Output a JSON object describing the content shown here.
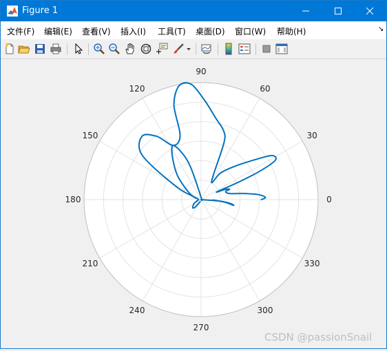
{
  "window": {
    "title": "Figure 1",
    "accent_color": "#0078d7",
    "controls": {
      "minimize_icon": "minimize-icon",
      "maximize_icon": "maximize-icon",
      "close_icon": "close-icon"
    }
  },
  "menu": {
    "items": [
      {
        "label": "文件(F)"
      },
      {
        "label": "编辑(E)"
      },
      {
        "label": "查看(V)"
      },
      {
        "label": "插入(I)"
      },
      {
        "label": "工具(T)"
      },
      {
        "label": "桌面(D)"
      },
      {
        "label": "窗口(W)"
      },
      {
        "label": "帮助(H)"
      }
    ],
    "overflow_icon": "dock-arrow-icon"
  },
  "toolbar": {
    "tools": [
      "new-figure-icon",
      "open-file-icon",
      "save-icon",
      "print-icon",
      "edit-plot-arrow-icon",
      "zoom-in-icon",
      "zoom-out-icon",
      "pan-hand-icon",
      "rotate-3d-icon",
      "data-cursor-icon",
      "brush-icon",
      "brush-dropdown-icon",
      "link-plot-icon",
      "insert-colorbar-icon",
      "insert-legend-icon",
      "hide-plot-tools-icon",
      "show-plot-tools-icon"
    ]
  },
  "chart_data": {
    "type": "polar-line",
    "theta_ticks_deg": [
      "0",
      "30",
      "60",
      "90",
      "120",
      "150",
      "180",
      "210",
      "240",
      "270",
      "300",
      "330"
    ],
    "r_ticks": [],
    "grid": true,
    "line_color": "#0072bd",
    "series": [
      {
        "points_theta_r": [
          [
            0,
            0.515
          ],
          [
            2,
            0.55
          ],
          [
            5,
            0.49
          ],
          [
            8,
            0.37
          ],
          [
            12,
            0.25
          ],
          [
            18,
            0.22
          ],
          [
            20,
            0.26
          ],
          [
            23,
            0.22
          ],
          [
            26,
            0.15
          ],
          [
            25,
            0.37
          ],
          [
            26,
            0.58
          ],
          [
            28,
            0.72
          ],
          [
            32,
            0.71
          ],
          [
            37,
            0.56
          ],
          [
            45,
            0.4
          ],
          [
            54,
            0.28
          ],
          [
            60,
            0.18
          ],
          [
            68,
            0.52
          ],
          [
            72,
            0.62
          ],
          [
            80,
            0.71
          ],
          [
            88,
            0.85
          ],
          [
            95,
            0.99
          ],
          [
            101,
            0.99
          ],
          [
            106,
            0.84
          ],
          [
            108,
            0.58
          ],
          [
            117,
            0.52
          ],
          [
            125,
            0.66
          ],
          [
            133,
            0.74
          ],
          [
            143,
            0.63
          ],
          [
            152,
            0.25
          ],
          [
            158,
            0.08
          ],
          [
            165,
            0.03
          ]
        ]
      },
      {
        "points_theta_r": [
          [
            0,
            0.0
          ],
          [
            90,
            0.02
          ],
          [
            108,
            0.3
          ],
          [
            113,
            0.45
          ],
          [
            118,
            0.52
          ],
          [
            125,
            0.42
          ],
          [
            135,
            0.28
          ],
          [
            150,
            0.12
          ],
          [
            165,
            0.05
          ]
        ]
      },
      {
        "points_theta_r": [
          [
            0,
            0.0
          ],
          [
            -5,
            0.18
          ],
          [
            -8,
            0.26
          ],
          [
            -10,
            0.28
          ],
          [
            -6,
            0.2
          ],
          [
            -2,
            0.1
          ]
        ]
      },
      {
        "points_theta_r": [
          [
            180,
            0.02
          ],
          [
            210,
            0.07
          ],
          [
            225,
            0.1
          ],
          [
            232,
            0.08
          ],
          [
            245,
            0.02
          ]
        ]
      }
    ]
  },
  "watermark": "CSDN @passionSnail"
}
